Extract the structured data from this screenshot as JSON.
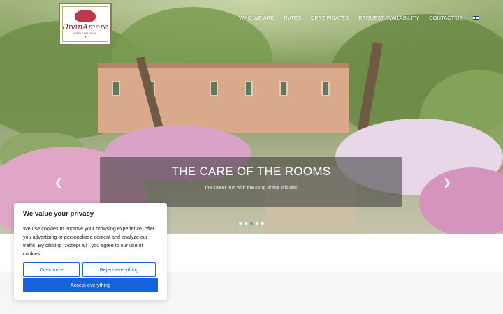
{
  "brand": {
    "name": "DivinAmore",
    "subtitle": "AGRITURISMO"
  },
  "nav": {
    "items": [
      {
        "label": "WHO WE ARE"
      },
      {
        "label": "RATES"
      },
      {
        "label": "CERTIFICATES"
      },
      {
        "label": "REQUEST AVAILABILITY"
      },
      {
        "label": "CONTACT US"
      }
    ],
    "language": "english-flag-icon"
  },
  "slider": {
    "title": "THE CARE OF THE ROOMS",
    "subtitle": "the sweet rest with the song of the crickets",
    "prev_icon": "chevron-left-icon",
    "next_icon": "chevron-right-icon",
    "dots": 5,
    "active_dot": 3
  },
  "cookie": {
    "title": "We value your privacy",
    "text": "We use cookies to improve your browsing experience, offer you advertising or personalized content and analyze our traffic. By clicking \"Accept all\", you agree to our use of cookies.",
    "customize_label": "Customize",
    "reject_label": "Reject everything",
    "accept_label": "Accept everything"
  },
  "colors": {
    "accent": "#1863dc",
    "logo": "#7a2b3c",
    "active_dot": "#3aa7d8"
  }
}
